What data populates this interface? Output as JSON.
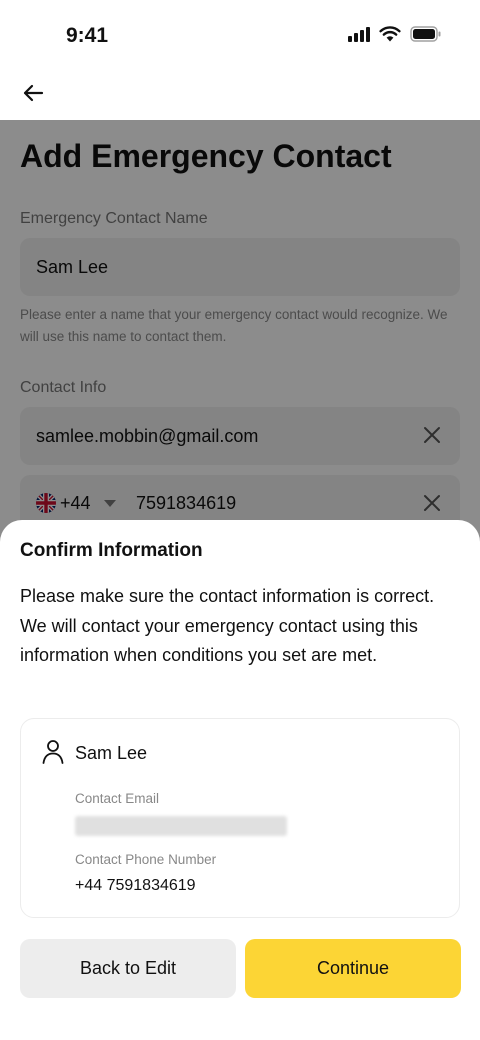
{
  "status_bar": {
    "time": "9:41"
  },
  "page": {
    "title": "Add Emergency Contact",
    "name_label": "Emergency Contact Name",
    "name_value": "Sam Lee",
    "name_helper": "Please enter a name that your emergency contact would recognize. We will use this name to contact them.",
    "contact_label": "Contact Info",
    "email_value": "samlee.mobbin@gmail.com",
    "dial_code": "+44",
    "phone_value": "7591834619"
  },
  "sheet": {
    "title": "Confirm Information",
    "description": "Please make sure the contact information is correct. We will contact your emergency contact using this information when conditions you set are met.",
    "card": {
      "name": "Sam Lee",
      "email_label": "Contact Email",
      "phone_label": "Contact Phone Number",
      "phone": "+44 7591834619"
    },
    "back_label": "Back to Edit",
    "continue_label": "Continue"
  },
  "colors": {
    "accent": "#fcd535",
    "secondary_button": "#ededed",
    "field_bg": "#f1f1f1"
  }
}
